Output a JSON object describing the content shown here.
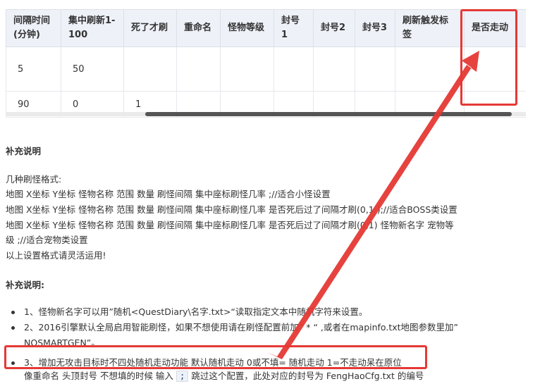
{
  "table": {
    "headers": [
      [
        "间隔时间",
        "(分钟)"
      ],
      [
        "集中刷新1-",
        "100"
      ],
      [
        "死了才刷"
      ],
      [
        "重命名"
      ],
      [
        "怪物等级"
      ],
      [
        "封号1"
      ],
      [
        "封号2"
      ],
      [
        "封号3"
      ],
      [
        "刷新触发标签"
      ],
      [
        "是否走动"
      ]
    ],
    "rows": [
      [
        "5",
        "50",
        "",
        "",
        "",
        "",
        "",
        "",
        "",
        ""
      ],
      [
        "90",
        "0",
        "1",
        "",
        "",
        "",
        "",
        "",
        "",
        ""
      ]
    ]
  },
  "doc": {
    "heading1": "补充说明",
    "formats_title": "几种刷怪格式:",
    "format_lines": [
      "地图    X坐标    Y坐标    怪物名称    范围    数量    刷怪间隔    集中座标刷怪几率 ;//适合小怪设置",
      "地图    X坐标    Y坐标    怪物名称    范围    数量    刷怪间隔    集中座标刷怪几率    是否死后过了间隔才刷(0,1 );//适合BOSS类设置",
      "地图    X坐标    Y坐标    怪物名称    范围    数量    刷怪间隔    集中座标刷怪几率    是否死后过了间隔才刷(0,1)    怪物新名字    宠物等",
      "级 ;//适合宠物类设置"
    ],
    "format_footer": "以上设置格式请灵活运用!",
    "heading2": "补充说明:",
    "notes": [
      {
        "text": "1、怪物新名字可以用”随机<QuestDiary\\名字.txt>“读取指定文本中随机字符来设置。"
      },
      {
        "text": "2、2016引擎默认全局启用智能刷怪，如果不想使用请在刷怪配置前加”  *  “ ,或者在mapinfo.txt地图参数里加”"
      },
      {
        "text": "NOSMARTGEN”。"
      },
      {
        "text": "3、增加无攻击目标时不四处随机走动功能 默认随机走动 0或不填= 随机走动 1=不走动呆在原位"
      }
    ],
    "partial_line_a": "像重命名 头顶封号 不想填的时候 输入",
    "partial_code": ";",
    "partial_line_b": "跳过这个配置，此处对应的封号为 FengHaoCfg.txt 的编号"
  },
  "colors": {
    "annotation": "#e53935",
    "header_bg": "#eef1f8"
  }
}
